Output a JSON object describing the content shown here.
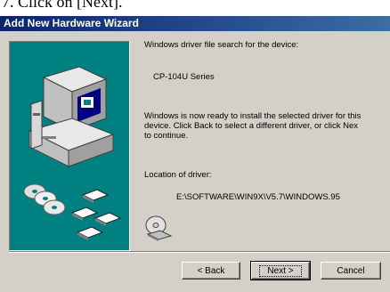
{
  "caption": "7. Click on [Next].",
  "window": {
    "title": "Add New Hardware Wizard"
  },
  "content": {
    "search_label": "Windows driver file search for the device:",
    "device_name": "CP-104U Series",
    "ready_text": "Windows is now ready to install the selected driver for this\ndevice. Click Back to select a different driver, or click Nex\nto continue.",
    "location_label": "Location of driver:",
    "driver_path": "E:\\SOFTWARE\\WIN9X\\V5.7\\WINDOWS.95"
  },
  "buttons": {
    "back": "< Back",
    "next": "Next >",
    "cancel": "Cancel"
  },
  "colors": {
    "titlebar": "#0a246a",
    "art_background": "#008080",
    "dialog_face": "#d4d0c8"
  }
}
